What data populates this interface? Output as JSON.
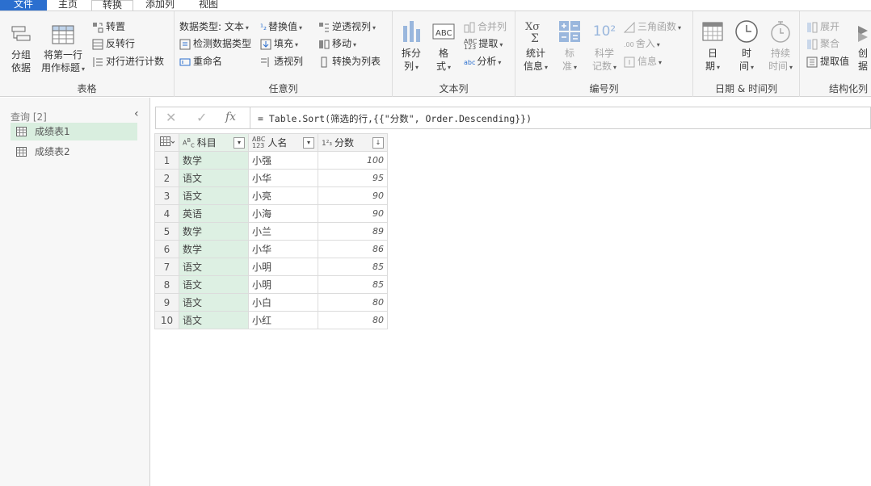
{
  "tabs": [
    {
      "label": "文件",
      "type": "file"
    },
    {
      "label": "主页",
      "type": "normal"
    },
    {
      "label": "转换",
      "type": "active"
    },
    {
      "label": "添加列",
      "type": "normal"
    },
    {
      "label": "视图",
      "type": "normal"
    }
  ],
  "ribbon": {
    "table": {
      "label": "表格",
      "group_by_l1": "分组",
      "group_by_l2": "依据",
      "first_row_l1": "将第一行",
      "first_row_l2": "用作标题",
      "transpose": "转置",
      "reverse_rows": "反转行",
      "count_rows": "对行进行计数"
    },
    "any_column": {
      "label": "任意列",
      "data_type": "数据类型: 文本",
      "detect_type": "检测数据类型",
      "rename": "重命名",
      "replace_values": "替换值",
      "fill": "填充",
      "pivot": "透视列",
      "unpivot": "逆透视列",
      "move": "移动",
      "to_list": "转换为列表"
    },
    "text_column": {
      "label": "文本列",
      "split_l1": "拆分",
      "split_l2": "列",
      "format_l1": "格",
      "format_l2": "式",
      "merge": "合并列",
      "extract": "提取",
      "parse": "分析"
    },
    "number_column": {
      "label": "编号列",
      "stats_l1": "统计",
      "stats_l2": "信息",
      "standard_l1": "标",
      "standard_l2": "准",
      "scientific_l1": "科学",
      "scientific_l2": "记数",
      "trig": "三角函数",
      "rounding": "舍入",
      "info": "信息",
      "sci_glyph": "10²"
    },
    "datetime": {
      "label": "日期 & 时间列",
      "date_l1": "日",
      "date_l2": "期",
      "time_l1": "时",
      "time_l2": "间",
      "duration_l1": "持续",
      "duration_l2": "时间"
    },
    "structured": {
      "label": "结构化列",
      "expand": "展开",
      "aggregate": "聚合",
      "extract_values": "提取值",
      "create_l1": "创",
      "create_l2": "据"
    }
  },
  "sidebar": {
    "title": "查询 [2]",
    "queries": [
      {
        "name": "成绩表1",
        "selected": true
      },
      {
        "name": "成绩表2",
        "selected": false
      }
    ]
  },
  "formula": {
    "text": "= Table.Sort(筛选的行,{{\"分数\", Order.Descending}})"
  },
  "grid": {
    "columns": [
      {
        "type": "ABC",
        "name": "科目"
      },
      {
        "type": "ABC123",
        "name": "人名"
      },
      {
        "type": "123",
        "name": "分数"
      }
    ],
    "rows": [
      {
        "n": "1",
        "subject": "数学",
        "name": "小强",
        "score": "100"
      },
      {
        "n": "2",
        "subject": "语文",
        "name": "小华",
        "score": "95"
      },
      {
        "n": "3",
        "subject": "语文",
        "name": "小亮",
        "score": "90"
      },
      {
        "n": "4",
        "subject": "英语",
        "name": "小海",
        "score": "90"
      },
      {
        "n": "5",
        "subject": "数学",
        "name": "小兰",
        "score": "89"
      },
      {
        "n": "6",
        "subject": "数学",
        "name": "小华",
        "score": "86"
      },
      {
        "n": "7",
        "subject": "语文",
        "name": "小明",
        "score": "85"
      },
      {
        "n": "8",
        "subject": "语文",
        "name": "小明",
        "score": "85"
      },
      {
        "n": "9",
        "subject": "语文",
        "name": "小白",
        "score": "80"
      },
      {
        "n": "10",
        "subject": "语文",
        "name": "小红",
        "score": "80"
      }
    ]
  },
  "colors": {
    "file_tab": "#2b6fcf",
    "selected_query": "#d9eedf",
    "selected_column": "#ddf0e3"
  }
}
